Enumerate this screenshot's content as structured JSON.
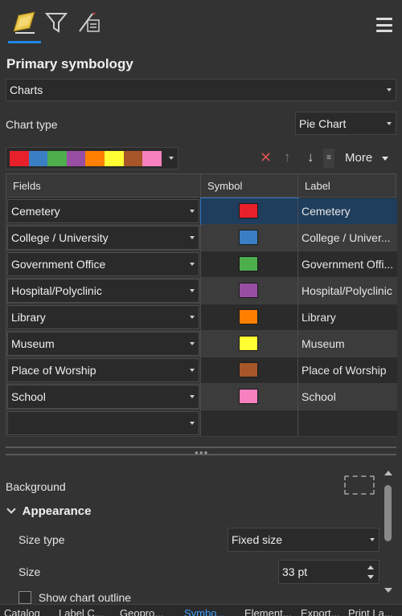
{
  "toolbar": {
    "tabs": [
      {
        "icon": "primary-symbology-icon"
      },
      {
        "icon": "vary-symbology-filter-icon"
      },
      {
        "icon": "symbol-layers-icon"
      }
    ],
    "menu_icon": "hamburger-menu-icon",
    "accent": "#1e88e5"
  },
  "primary_symbology": {
    "title": "Primary symbology",
    "selected": "Charts"
  },
  "chart_type": {
    "label": "Chart type",
    "selected": "Pie Chart"
  },
  "color_scheme": [
    "#e8202a",
    "#3a7fc4",
    "#4caf4c",
    "#984ea3",
    "#ff7f00",
    "#ffff33",
    "#a65628",
    "#f781bf"
  ],
  "actions": {
    "remove_icon": "remove-x-icon",
    "up_icon": "move-up-icon",
    "down_icon": "move-down-icon",
    "more_label": "More"
  },
  "grid": {
    "headers": [
      "Fields",
      "Symbol",
      "Label"
    ],
    "rows": [
      {
        "field": "Cemetery",
        "color": "#e8202a",
        "label": "Cemetery"
      },
      {
        "field": "College / University",
        "color": "#3a7fc4",
        "label": "College / Univer..."
      },
      {
        "field": "Government Office",
        "color": "#4caf4c",
        "label": "Government Offi..."
      },
      {
        "field": "Hospital/Polyclinic",
        "color": "#984ea3",
        "label": "Hospital/Polyclinic"
      },
      {
        "field": "Library",
        "color": "#ff7f00",
        "label": "Library"
      },
      {
        "field": "Museum",
        "color": "#ffff33",
        "label": "Museum"
      },
      {
        "field": "Place of Worship",
        "color": "#a65628",
        "label": "Place of Worship"
      },
      {
        "field": "School",
        "color": "#f781bf",
        "label": "School"
      },
      {
        "field": "",
        "color": "",
        "label": ""
      }
    ]
  },
  "background": {
    "label": "Background"
  },
  "appearance": {
    "label": "Appearance",
    "size_type_label": "Size type",
    "size_type_value": "Fixed size",
    "size_label": "Size",
    "size_value": "33 pt",
    "outline_label": "Show chart outline"
  },
  "bottom_tabs": [
    "Catalog",
    "Label C...",
    "Geopro...",
    "Symbo...",
    "Element...",
    "Export...",
    "Print La..."
  ],
  "active_tab": "Symbo..."
}
